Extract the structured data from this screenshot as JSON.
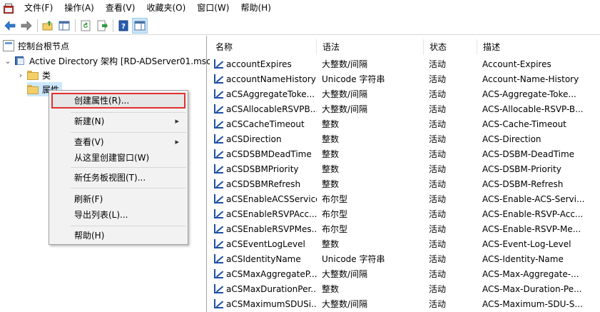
{
  "menubar": {
    "items": [
      "文件(F)",
      "操作(A)",
      "查看(V)",
      "收藏夹(O)",
      "窗口(W)",
      "帮助(H)"
    ]
  },
  "toolbar": {
    "buttons": [
      "back-icon",
      "forward-icon",
      "up-folder-icon",
      "show-hide-tree-icon",
      "refresh-icon",
      "export-list-icon",
      "help-icon",
      "show-action-pane-icon"
    ]
  },
  "tree": {
    "root": "控制台根节点",
    "snapin": "Active Directory 架构 [RD-ADServer01.msc",
    "children": [
      "类",
      "属性"
    ]
  },
  "list": {
    "headers": [
      "名称",
      "语法",
      "状态",
      "描述"
    ],
    "rows": [
      {
        "name": "accountExpires",
        "syntax": "大整数/间隔",
        "status": "活动",
        "desc": "Account-Expires"
      },
      {
        "name": "accountNameHistory",
        "syntax": "Unicode 字符串",
        "status": "活动",
        "desc": "Account-Name-History"
      },
      {
        "name": "aCSAggregateToke...",
        "syntax": "大整数/间隔",
        "status": "活动",
        "desc": "ACS-Aggregate-Toke..."
      },
      {
        "name": "aCSAllocableRSVPB...",
        "syntax": "大整数/间隔",
        "status": "活动",
        "desc": "ACS-Allocable-RSVP-B..."
      },
      {
        "name": "aCSCacheTimeout",
        "syntax": "整数",
        "status": "活动",
        "desc": "ACS-Cache-Timeout"
      },
      {
        "name": "aCSDirection",
        "syntax": "整数",
        "status": "活动",
        "desc": "ACS-Direction"
      },
      {
        "name": "aCSDSBMDeadTime",
        "syntax": "整数",
        "status": "活动",
        "desc": "ACS-DSBM-DeadTime"
      },
      {
        "name": "aCSDSBMPriority",
        "syntax": "整数",
        "status": "活动",
        "desc": "ACS-DSBM-Priority"
      },
      {
        "name": "aCSDSBMRefresh",
        "syntax": "整数",
        "status": "活动",
        "desc": "ACS-DSBM-Refresh"
      },
      {
        "name": "aCSEnableACSService",
        "syntax": "布尔型",
        "status": "活动",
        "desc": "ACS-Enable-ACS-Servi..."
      },
      {
        "name": "aCSEnableRSVPAcc...",
        "syntax": "布尔型",
        "status": "活动",
        "desc": "ACS-Enable-RSVP-Acc..."
      },
      {
        "name": "aCSEnableRSVPMes...",
        "syntax": "布尔型",
        "status": "活动",
        "desc": "ACS-Enable-RSVP-Me..."
      },
      {
        "name": "aCSEventLogLevel",
        "syntax": "整数",
        "status": "活动",
        "desc": "ACS-Event-Log-Level"
      },
      {
        "name": "aCSIdentityName",
        "syntax": "Unicode 字符串",
        "status": "活动",
        "desc": "ACS-Identity-Name"
      },
      {
        "name": "aCSMaxAggregateP...",
        "syntax": "大整数/间隔",
        "status": "活动",
        "desc": "ACS-Max-Aggregate-..."
      },
      {
        "name": "aCSMaxDurationPer...",
        "syntax": "整数",
        "status": "活动",
        "desc": "ACS-Max-Duration-Pe..."
      },
      {
        "name": "aCSMaximumSDUSi...",
        "syntax": "大整数/间隔",
        "status": "活动",
        "desc": "ACS-Maximum-SDU-S..."
      }
    ]
  },
  "context_menu": {
    "create_attribute": "创建属性(R)...",
    "new": "新建(N)",
    "view": "查看(V)",
    "new_window_from_here": "从这里创建窗口(W)",
    "new_taskpad_view": "新任务板视图(T)...",
    "refresh": "刷新(F)",
    "export_list": "导出列表(L)...",
    "help": "帮助(H)"
  },
  "colors": {
    "highlight_border": "#e03131",
    "selected_node": "#cce8ff",
    "menu_bg": "#f2f2f2"
  }
}
